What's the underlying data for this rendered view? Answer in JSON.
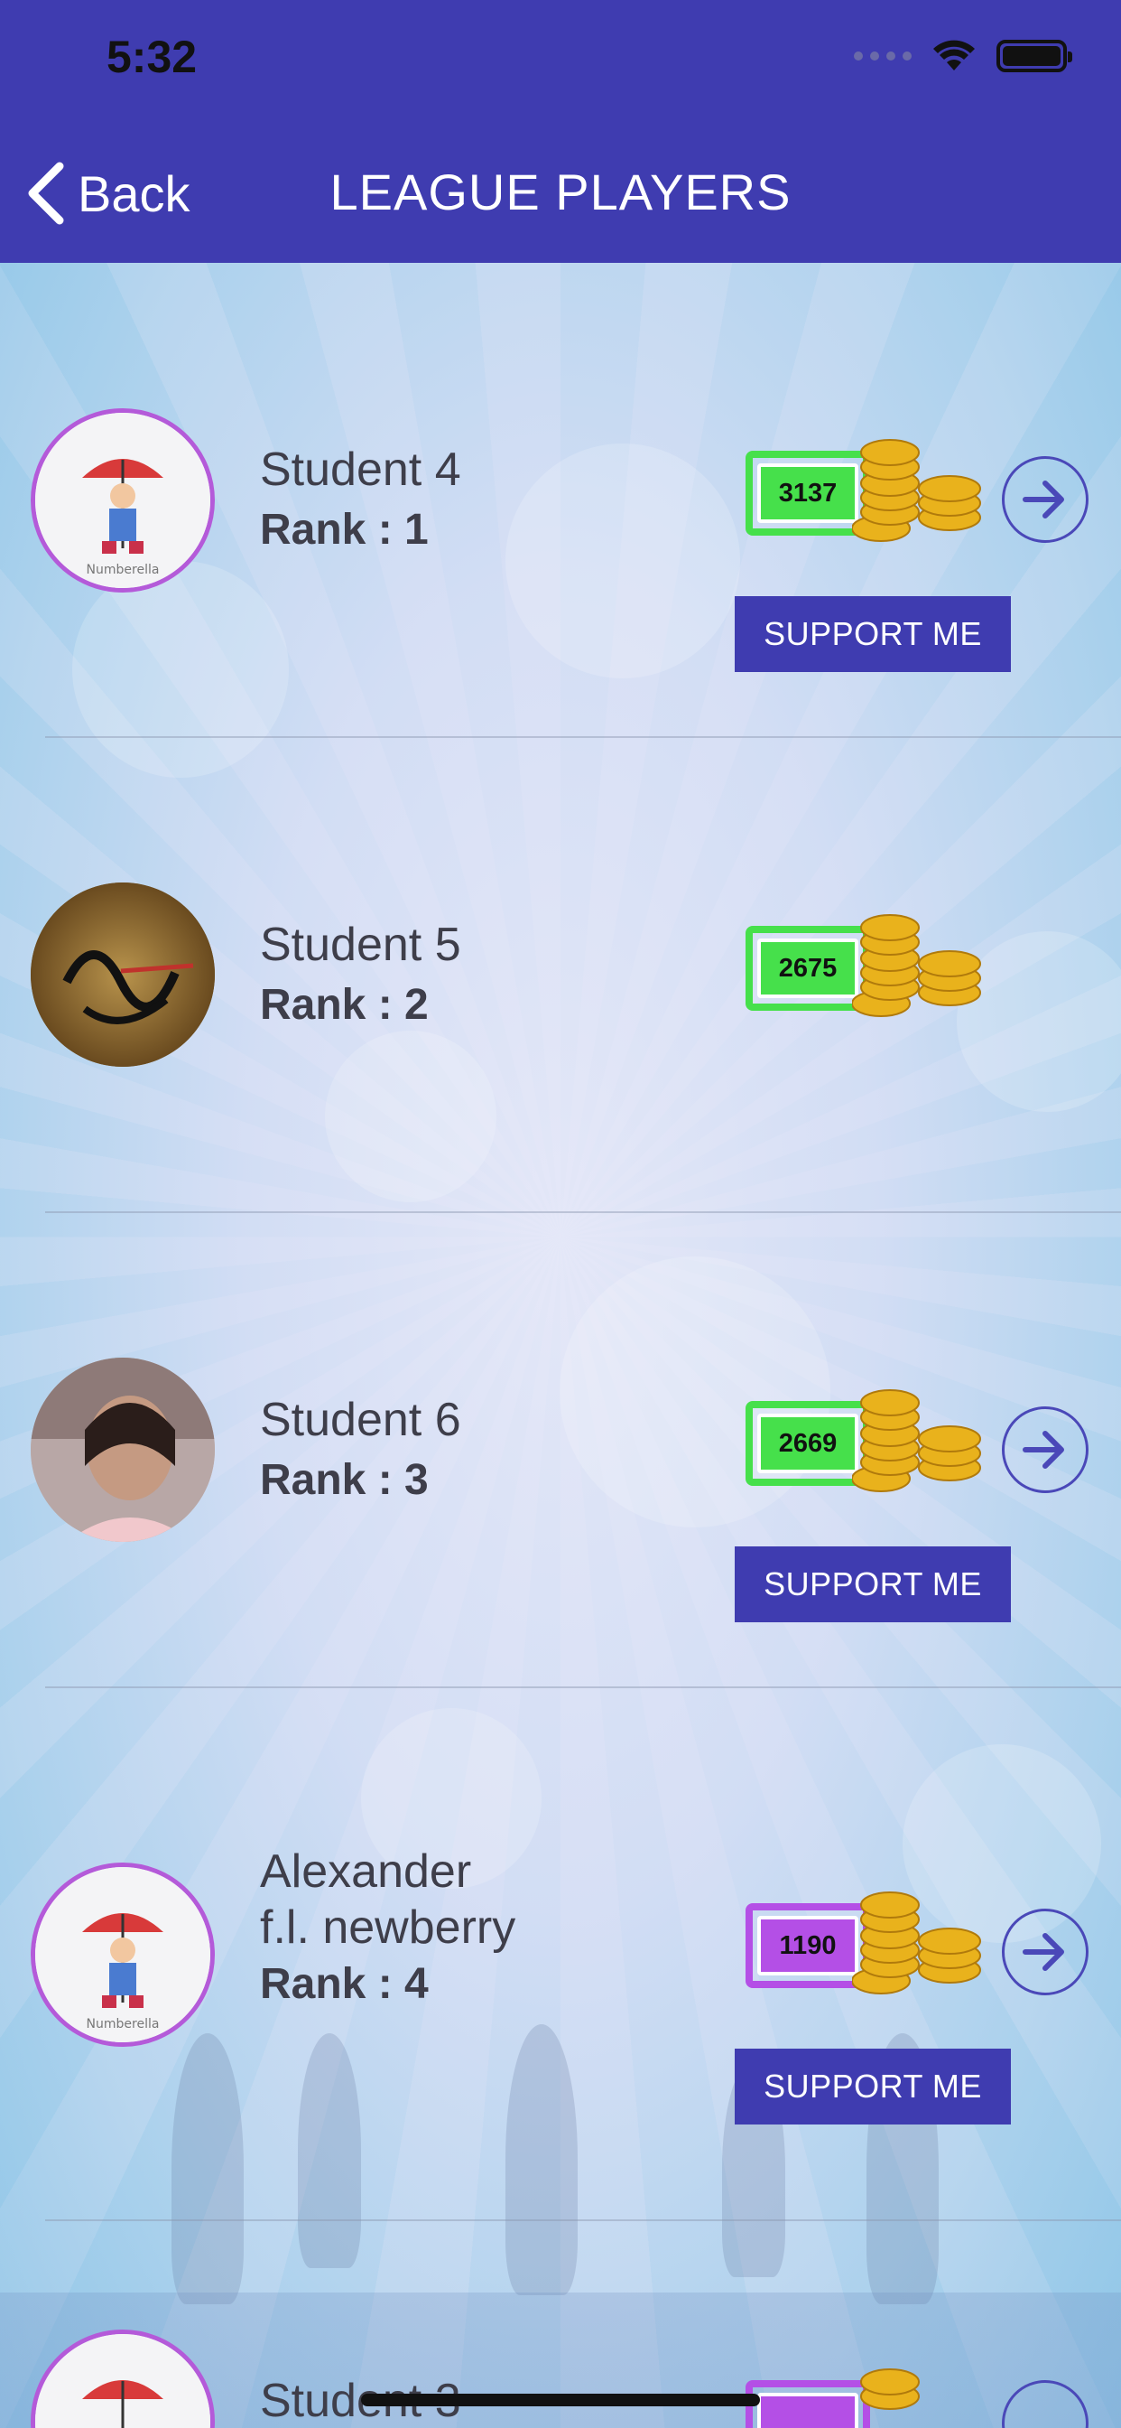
{
  "status_bar": {
    "time": "5:32"
  },
  "header": {
    "back_label": "Back",
    "title": "LEAGUE PLAYERS"
  },
  "colors": {
    "header": "#3f3cb0",
    "coin_green": "#46e04b",
    "coin_purple": "#b44fe6",
    "button": "#3f3cb0"
  },
  "players": [
    {
      "name": "Student 4",
      "rank": "Rank : 1",
      "coins": "3137",
      "coin_color": "green",
      "support_label": "SUPPORT ME",
      "avatar": "umbrella-logo-avatar"
    },
    {
      "name": "Student 5",
      "rank": "Rank : 2",
      "coins": "2675",
      "coin_color": "green",
      "avatar": "calligraphy-avatar"
    },
    {
      "name": "Student 6",
      "rank": "Rank : 3",
      "coins": "2669",
      "coin_color": "green",
      "support_label": "SUPPORT ME",
      "avatar": "photo-avatar"
    },
    {
      "name_line1": "Alexander",
      "name_line2": "f.l. newberry",
      "rank": "Rank : 4",
      "coins": "1190",
      "coin_color": "purple",
      "support_label": "SUPPORT ME",
      "avatar": "umbrella-logo-avatar"
    },
    {
      "name": "Student 3",
      "coin_color": "purple",
      "avatar": "umbrella-logo-avatar"
    }
  ]
}
